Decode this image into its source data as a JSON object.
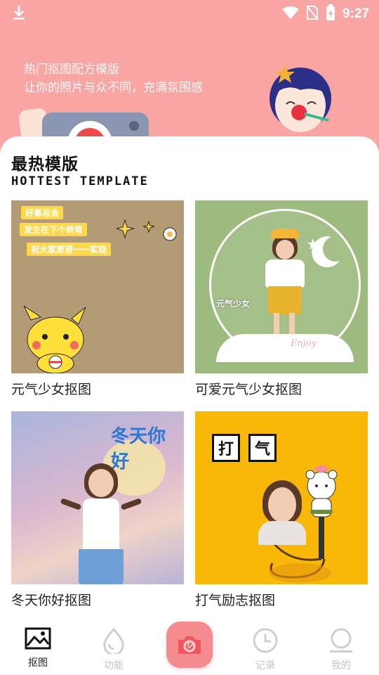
{
  "status_bar": {
    "time": "9:27"
  },
  "banner": {
    "line1": "热门抠图配方模版",
    "line2": "让你的照片与众不同，充满氛围感"
  },
  "section": {
    "title": "最热模版",
    "subtitle": "HOTTEST TEMPLATE"
  },
  "templates": [
    {
      "label": "元气少女抠图",
      "tags": [
        "好事总会",
        "发生在下个转弯",
        "祝大家愿望一一实现"
      ]
    },
    {
      "label": "可爱元气少女抠图",
      "caption": "元气少女",
      "signature": "Enjoy"
    },
    {
      "label": "冬天你好抠图",
      "caption": "冬天你好"
    },
    {
      "label": "打气励志抠图",
      "chars": [
        "打",
        "气"
      ]
    }
  ],
  "bottom_nav": {
    "items": [
      {
        "label": "抠图",
        "icon": "image-icon",
        "active": true
      },
      {
        "label": "功能",
        "icon": "drop-icon",
        "active": false
      },
      {
        "label": "记录",
        "icon": "clock-icon",
        "active": false
      },
      {
        "label": "我的",
        "icon": "profile-icon",
        "active": false
      }
    ],
    "center_icon": "camera-icon"
  },
  "colors": {
    "banner": "#f8a5a4",
    "accent": "#f48b8e",
    "tile_1": "#b39b75",
    "tile_2": "#9ebb7f",
    "tile_4": "#f9b708"
  }
}
